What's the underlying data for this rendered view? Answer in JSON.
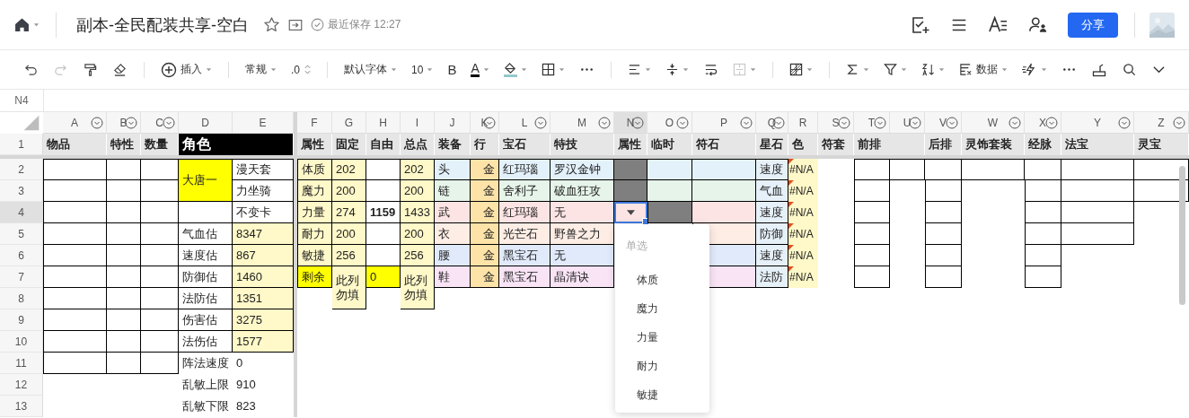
{
  "header": {
    "title": "副本-全民配装共享-空白",
    "save_status": "最近保存 12:27",
    "share": "分享"
  },
  "toolbar": {
    "insert": "插入",
    "format": "常规",
    "decimal": ".0",
    "font": "默认字体",
    "size": "10",
    "bold": "B",
    "font_color": "A",
    "data": "数据",
    "redo": {
      "disabled": true
    },
    "merge": {
      "disabled": true
    }
  },
  "formula_bar": {
    "cell": "N4"
  },
  "sheet": {
    "columns": [
      {
        "letter": "A",
        "filter": true,
        "selected": false
      },
      {
        "letter": "B",
        "filter": true,
        "selected": false
      },
      {
        "letter": "C",
        "filter": true,
        "selected": false
      },
      {
        "letter": "D",
        "filter": false,
        "selected": false
      },
      {
        "letter": "E",
        "filter": false,
        "selected": false
      },
      {
        "letter": "F",
        "filter": false,
        "selected": false
      },
      {
        "letter": "G",
        "filter": false,
        "selected": false
      },
      {
        "letter": "H",
        "filter": false,
        "selected": false
      },
      {
        "letter": "I",
        "filter": false,
        "selected": false
      },
      {
        "letter": "J",
        "filter": false,
        "selected": false
      },
      {
        "letter": "K",
        "filter": true,
        "selected": false
      },
      {
        "letter": "L",
        "filter": true,
        "selected": false
      },
      {
        "letter": "M",
        "filter": true,
        "selected": false
      },
      {
        "letter": "N",
        "filter": true,
        "selected": true
      },
      {
        "letter": "O",
        "filter": true,
        "selected": false
      },
      {
        "letter": "P",
        "filter": true,
        "selected": false
      },
      {
        "letter": "Q",
        "filter": true,
        "selected": false
      },
      {
        "letter": "R",
        "filter": false,
        "selected": false
      },
      {
        "letter": "S",
        "filter": true,
        "selected": false
      },
      {
        "letter": "T",
        "filter": true,
        "selected": false
      },
      {
        "letter": "U",
        "filter": true,
        "selected": false
      },
      {
        "letter": "V",
        "filter": true,
        "selected": false
      },
      {
        "letter": "W",
        "filter": true,
        "selected": false
      },
      {
        "letter": "X",
        "filter": true,
        "selected": false
      },
      {
        "letter": "Y",
        "filter": true,
        "selected": false
      },
      {
        "letter": "Z",
        "filter": true,
        "selected": false
      }
    ],
    "rows": [
      {
        "number": "1",
        "selected": false,
        "kind": "header",
        "cells": [
          {
            "text": "物品",
            "color": "#e6e6e6"
          },
          {
            "text": "特性",
            "color": "#e6e6e6"
          },
          {
            "text": "数量",
            "color": "#e6e6e6"
          },
          {
            "text": "角色",
            "merge_right": true,
            "color": "#000000",
            "large": true
          },
          "",
          {
            "text": "属性",
            "color": "#e6e6e6"
          },
          {
            "text": "固定",
            "color": "#e6e6e6"
          },
          {
            "text": "自由",
            "color": "#e6e6e6"
          },
          {
            "text": "总点",
            "color": "#e6e6e6"
          },
          {
            "text": "装备",
            "color": "#e6e6e6"
          },
          {
            "text": "行",
            "color": "#e6e6e6"
          },
          {
            "text": "宝石",
            "color": "#e6e6e6"
          },
          {
            "text": "特技",
            "color": "#e6e6e6"
          },
          {
            "text": "属性",
            "color": "#e6e6e6"
          },
          {
            "text": "临时",
            "color": "#e6e6e6"
          },
          {
            "text": "符石",
            "color": "#e6e6e6"
          },
          {
            "text": "星石",
            "color": "#e6e6e6"
          },
          {
            "text": "色",
            "color": "#e6e6e6"
          },
          {
            "text": "符套",
            "color": "#e6e6e6"
          },
          {
            "text": "前排",
            "merge_right": true,
            "color": "#e6e6e6"
          },
          "",
          {
            "text": "后排",
            "color": "#e6e6e6"
          },
          {
            "text": "灵饰套装",
            "color": "#e6e6e6"
          },
          {
            "text": "经脉",
            "color": "#e6e6e6"
          },
          {
            "text": "法宝",
            "color": "#e6e6e6"
          },
          {
            "text": "灵宝",
            "color": "#e6e6e6"
          }
        ]
      },
      {
        "number": "2",
        "selected": false,
        "kind": "data",
        "cells": [
          {
            "border": true
          },
          {
            "border": true
          },
          {
            "border": true
          },
          {
            "text": "大唐一",
            "merge_down": true,
            "color": "#ffff00",
            "border": true
          },
          {
            "text": "漫天套",
            "border": true
          },
          {
            "text": "体质",
            "color": "#fff8c8",
            "border": true
          },
          {
            "text": "202",
            "color": "#fff8c8",
            "border": true
          },
          {
            "border": true
          },
          {
            "text": "202",
            "color": "#fff8c8",
            "border": true
          },
          {
            "text": "头",
            "color": "#e3f1fb",
            "border": true
          },
          {
            "text": "金",
            "color": "#fde3a8",
            "border": true,
            "right_aligned": true
          },
          {
            "text": "红玛瑙",
            "color": "#e3f1fb",
            "border": true
          },
          {
            "text": "罗汉金钟",
            "color": "#e3f1fb",
            "border": true
          },
          {
            "color": "#7f7f7f",
            "border": true
          },
          {
            "color": "#e3f1fb",
            "border": true
          },
          {
            "color": "#e3f1fb",
            "border": true
          },
          {
            "text": "速度",
            "color": "#e6f0f8",
            "border": true
          },
          {
            "text": "#N/A",
            "color": "#fff8c8",
            "error": true
          },
          "",
          {
            "border": true
          },
          {
            "border": true
          },
          {
            "border": true
          },
          {
            "border": true
          },
          {
            "border": true
          },
          {
            "border": true
          },
          {
            "border": true
          }
        ]
      },
      {
        "number": "3",
        "selected": false,
        "kind": "data",
        "cells": [
          {
            "border": true
          },
          {
            "border": true
          },
          {
            "border": true
          },
          "",
          {
            "text": "力坐骑",
            "border": true
          },
          {
            "text": "魔力",
            "color": "#fff8c8",
            "border": true
          },
          {
            "text": "200",
            "color": "#fff8c8",
            "border": true
          },
          {
            "border": true
          },
          {
            "text": "200",
            "color": "#fff8c8",
            "border": true
          },
          {
            "text": "链",
            "color": "#e6f4ea",
            "border": true
          },
          {
            "text": "金",
            "color": "#fde3a8",
            "border": true,
            "right_aligned": true
          },
          {
            "text": "舍利子",
            "color": "#e6f4ea",
            "border": true
          },
          {
            "text": "破血狂攻",
            "color": "#e6f4ea",
            "border": true
          },
          {
            "color": "#7f7f7f",
            "border": true
          },
          {
            "color": "#e6f4ea",
            "border": true
          },
          {
            "color": "#e6f4ea",
            "border": true
          },
          {
            "text": "气血",
            "color": "#e6f0f8",
            "border": true
          },
          {
            "text": "#N/A",
            "color": "#fff8c8",
            "error": true
          },
          "",
          {
            "border": true
          },
          "",
          {
            "border": true
          },
          "",
          {
            "border": true
          },
          {
            "border": true
          },
          {
            "border": true
          }
        ]
      },
      {
        "number": "4",
        "selected": true,
        "kind": "data",
        "cells": [
          {
            "border": true
          },
          {
            "border": true
          },
          {
            "border": true
          },
          {
            "border": true
          },
          {
            "text": "不变卡",
            "border": true
          },
          {
            "text": "力量",
            "color": "#fff8c8",
            "border": true
          },
          {
            "text": "274",
            "color": "#fff8c8",
            "border": true
          },
          {
            "text": "1159",
            "bold": true,
            "border": true
          },
          {
            "text": "1433",
            "color": "#fff8c8",
            "border": true
          },
          {
            "text": "武",
            "color": "#fde4e4",
            "border": true
          },
          {
            "text": "金",
            "color": "#fde3a8",
            "border": true,
            "right_aligned": true
          },
          {
            "text": "红玛瑙",
            "color": "#fde4e4",
            "border": true
          },
          {
            "text": "无",
            "color": "#fde4e4",
            "border": true
          },
          {
            "color": "#fde4e4",
            "selected": true
          },
          {
            "color": "#7f7f7f",
            "border": true
          },
          {
            "color": "#fde4e4",
            "border": true
          },
          {
            "text": "速度",
            "color": "#e6f0f8",
            "border": true
          },
          {
            "text": "#N/A",
            "color": "#fff8c8",
            "error": true
          },
          "",
          {
            "border": true
          },
          "",
          {
            "border": true
          },
          "",
          {
            "border": true
          },
          {
            "border": true
          }
        ]
      },
      {
        "number": "5",
        "selected": false,
        "kind": "data",
        "cells": [
          {
            "border": true
          },
          {
            "border": true
          },
          {
            "border": true
          },
          {
            "text": "气血估",
            "border": true
          },
          {
            "text": "8347",
            "color": "#fff8c8",
            "border": true
          },
          {
            "text": "耐力",
            "color": "#fff8c8",
            "border": true
          },
          {
            "text": "200",
            "color": "#fff8c8",
            "border": true
          },
          {
            "border": true
          },
          {
            "text": "200",
            "color": "#fff8c8",
            "border": true
          },
          {
            "text": "衣",
            "color": "#fdede5",
            "border": true
          },
          {
            "text": "金",
            "color": "#fde3a8",
            "border": true,
            "right_aligned": true
          },
          {
            "text": "光芒石",
            "color": "#fdede5",
            "border": true
          },
          {
            "text": "野兽之力",
            "color": "#fdede5",
            "border": true
          },
          "",
          "",
          {
            "color": "#fdede5",
            "border": true
          },
          {
            "text": "防御",
            "color": "#e6f0f8",
            "border": true
          },
          {
            "text": "#N/A",
            "color": "#fff8c8",
            "error": true
          },
          "",
          {
            "border": true
          },
          "",
          {
            "border": true
          },
          "",
          {
            "border": true
          },
          {
            "border": true
          }
        ]
      },
      {
        "number": "6",
        "selected": false,
        "kind": "data",
        "cells": [
          {
            "border": true
          },
          {
            "border": true
          },
          {
            "border": true
          },
          {
            "text": "速度估",
            "border": true
          },
          {
            "text": "867",
            "color": "#fff8c8",
            "border": true
          },
          {
            "text": "敏捷",
            "color": "#fff8c8",
            "border": true
          },
          {
            "text": "256",
            "color": "#fff8c8",
            "border": true
          },
          {
            "border": true
          },
          {
            "text": "256",
            "color": "#fff8c8",
            "border": true
          },
          {
            "text": "腰",
            "color": "#e1eafb",
            "border": true
          },
          {
            "text": "金",
            "color": "#fde3a8",
            "border": true,
            "right_aligned": true
          },
          {
            "text": "黑宝石",
            "color": "#e1eafb",
            "border": true
          },
          {
            "text": "无",
            "color": "#e1eafb",
            "border": true
          },
          "",
          "",
          {
            "color": "#e1eafb",
            "border": true
          },
          {
            "text": "速度",
            "color": "#e6f0f8",
            "border": true
          },
          {
            "text": "#N/A",
            "color": "#fff8c8",
            "error": true
          },
          "",
          {
            "border": true
          },
          "",
          {
            "border": true
          },
          "",
          {
            "border": true
          }
        ]
      },
      {
        "number": "7",
        "selected": false,
        "kind": "data",
        "cells": [
          {
            "border": true
          },
          {
            "border": true
          },
          {
            "border": true
          },
          {
            "text": "防御估",
            "border": true
          },
          {
            "text": "1460",
            "color": "#fff8c8",
            "border": true
          },
          {
            "text": "剩余",
            "color": "#ffff00",
            "border": true
          },
          {
            "text": "此列勿填",
            "merge_down": true,
            "color": "#fff8c8",
            "border": true
          },
          {
            "text": "0",
            "color": "#ffff00",
            "border": true
          },
          {
            "text": "此列勿填",
            "merge_down": true,
            "color": "#fff8c8",
            "border": true
          },
          {
            "text": "鞋",
            "color": "#f9e4f6",
            "border": true
          },
          {
            "text": "金",
            "color": "#fde3a8",
            "border": true,
            "right_aligned": true
          },
          {
            "text": "黑宝石",
            "color": "#f9e4f6",
            "border": true
          },
          {
            "text": "晶清诀",
            "color": "#f9e4f6",
            "border": true
          },
          "",
          "",
          {
            "color": "#f9e4f6",
            "border": true
          },
          {
            "text": "法防",
            "color": "#e6f0f8",
            "border": true
          },
          {
            "text": "#N/A",
            "color": "#fff8c8",
            "error": true
          },
          "",
          {
            "border": true
          },
          "",
          {
            "border": true
          },
          "",
          {
            "border": true
          }
        ]
      },
      {
        "number": "8",
        "selected": false,
        "kind": "data",
        "cells": [
          {
            "border": true
          },
          {
            "border": true
          },
          {
            "border": true
          },
          {
            "text": "法防估",
            "border": true
          },
          {
            "text": "1351",
            "color": "#fff8c8",
            "border": true
          }
        ]
      },
      {
        "number": "9",
        "selected": false,
        "kind": "data",
        "cells": [
          {
            "border": true
          },
          {
            "border": true
          },
          {
            "border": true
          },
          {
            "text": "伤害估",
            "border": true
          },
          {
            "text": "3275",
            "color": "#fff8c8",
            "border": true
          }
        ]
      },
      {
        "number": "10",
        "selected": false,
        "kind": "data",
        "cells": [
          {
            "border": true
          },
          {
            "border": true
          },
          {
            "border": true
          },
          {
            "text": "法伤估",
            "border": true
          },
          {
            "text": "1577",
            "color": "#fff8c8",
            "border": true
          }
        ]
      },
      {
        "number": "11",
        "selected": false,
        "kind": "data",
        "cells": [
          {
            "border": true
          },
          {
            "border": true
          },
          {
            "border": true
          },
          {
            "text": "阵法速度"
          },
          {
            "text": "0"
          }
        ]
      },
      {
        "number": "12",
        "selected": false,
        "kind": "data",
        "cells": [
          "",
          "",
          "",
          {
            "text": "乱敏上限"
          },
          {
            "text": "910"
          }
        ]
      },
      {
        "number": "13",
        "selected": false,
        "kind": "data",
        "cells": [
          "",
          "",
          "",
          {
            "text": "乱敏下限"
          },
          {
            "text": "823"
          }
        ]
      }
    ]
  },
  "dropdown": {
    "heading": "单选",
    "options": [
      {
        "label": "体质",
        "selected": false
      },
      {
        "label": "魔力",
        "selected": false
      },
      {
        "label": "力量",
        "selected": false
      },
      {
        "label": "耐力",
        "selected": false
      },
      {
        "label": "敏捷",
        "selected": false
      }
    ]
  }
}
